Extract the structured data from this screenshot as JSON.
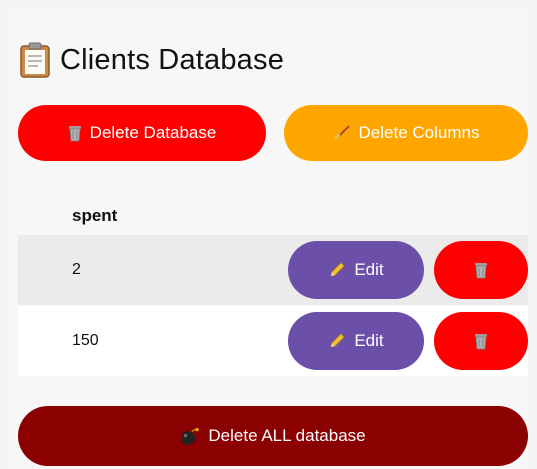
{
  "title": {
    "icon": "clipboard-icon",
    "text": "Clients Database"
  },
  "actions": {
    "delete_database": {
      "icon": "trash-icon",
      "label": "Delete Database",
      "color": "#ff0000"
    },
    "delete_columns": {
      "icon": "broom-icon",
      "label": "Delete Columns",
      "color": "#ffa500"
    }
  },
  "table": {
    "columns": [
      "spent"
    ],
    "rows": [
      {
        "spent": "2"
      },
      {
        "spent": "150"
      }
    ],
    "edit_label": "Edit",
    "edit_icon": "pencil-icon",
    "delete_icon": "trash-icon",
    "edit_color": "#6b4fa8",
    "delete_color": "#ff0000"
  },
  "footer": {
    "delete_all": {
      "icon": "bomb-icon",
      "label": "Delete ALL database",
      "color": "#8b0000"
    }
  }
}
